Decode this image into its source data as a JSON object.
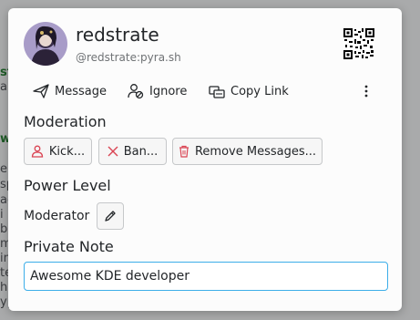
{
  "background_fragments": [
    "st",
    "ah",
    "w",
    "e",
    "sp",
    "ac",
    "i",
    "b",
    "m",
    "in",
    "te",
    "ha",
    "yp",
    "m",
    "g"
  ],
  "profile": {
    "display_name": "redstrate",
    "user_id": "@redstrate:pyra.sh",
    "avatar_icon": "user-avatar",
    "qr_icon": "qr-code-icon"
  },
  "actions": {
    "message": "Message",
    "ignore": "Ignore",
    "copy_link": "Copy Link"
  },
  "moderation": {
    "heading": "Moderation",
    "kick": "Kick...",
    "ban": "Ban...",
    "remove_messages": "Remove Messages..."
  },
  "power_level": {
    "heading": "Power Level",
    "value": "Moderator"
  },
  "private_note": {
    "heading": "Private Note",
    "value": "Awesome KDE developer"
  },
  "colors": {
    "accent": "#3daee9",
    "danger": "#da4453",
    "text": "#232629",
    "muted": "#6f7275"
  }
}
